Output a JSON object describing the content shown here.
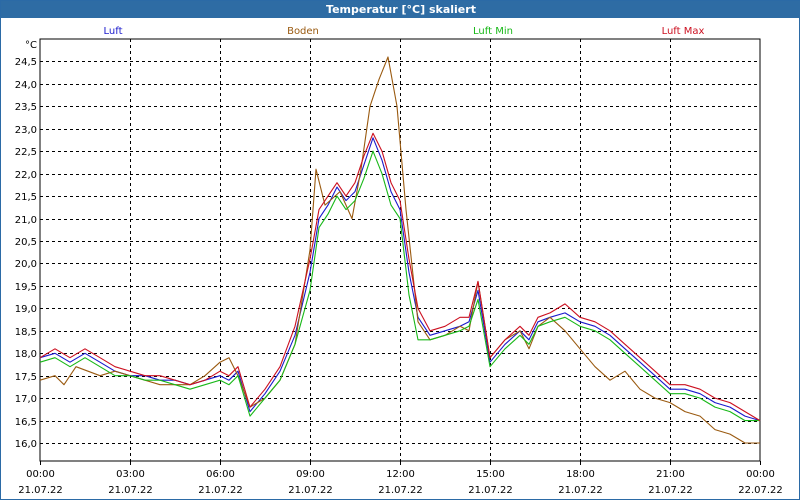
{
  "window": {
    "title": "Temperatur [°C] skaliert"
  },
  "chart_data": {
    "type": "line",
    "title": "Temperatur [°C] skaliert",
    "ylabel": "°C",
    "ylim": [
      15.6,
      25.0
    ],
    "yticks": [
      "16,0",
      "16,5",
      "17,0",
      "17,5",
      "18,0",
      "18,5",
      "19,0",
      "19,5",
      "20,0",
      "20,5",
      "21,0",
      "21,5",
      "22,0",
      "22,5",
      "23,0",
      "23,5",
      "24,0",
      "24,5"
    ],
    "ytick_values": [
      16.0,
      16.5,
      17.0,
      17.5,
      18.0,
      18.5,
      19.0,
      19.5,
      20.0,
      20.5,
      21.0,
      21.5,
      22.0,
      22.5,
      23.0,
      23.5,
      24.0,
      24.5
    ],
    "xlim": [
      0,
      24
    ],
    "xticks": [
      {
        "h": 0,
        "time": "00:00",
        "date": "21.07.22"
      },
      {
        "h": 3,
        "time": "03:00",
        "date": "21.07.22"
      },
      {
        "h": 6,
        "time": "06:00",
        "date": "21.07.22"
      },
      {
        "h": 9,
        "time": "09:00",
        "date": "21.07.22"
      },
      {
        "h": 12,
        "time": "12:00",
        "date": "21.07.22"
      },
      {
        "h": 15,
        "time": "15:00",
        "date": "21.07.22"
      },
      {
        "h": 18,
        "time": "18:00",
        "date": "21.07.22"
      },
      {
        "h": 21,
        "time": "21:00",
        "date": "21.07.22"
      },
      {
        "h": 24,
        "time": "00:00",
        "date": "22.07.22"
      }
    ],
    "grid": true,
    "legend_position": "top",
    "series": [
      {
        "name": "Luft",
        "color": "#1a1acc",
        "points": [
          [
            0,
            17.9
          ],
          [
            0.5,
            18.0
          ],
          [
            1,
            17.8
          ],
          [
            1.5,
            18.0
          ],
          [
            2,
            17.8
          ],
          [
            2.5,
            17.6
          ],
          [
            3,
            17.5
          ],
          [
            3.5,
            17.5
          ],
          [
            4,
            17.4
          ],
          [
            4.5,
            17.4
          ],
          [
            5,
            17.3
          ],
          [
            5.5,
            17.4
          ],
          [
            6,
            17.5
          ],
          [
            6.3,
            17.4
          ],
          [
            6.6,
            17.6
          ],
          [
            7,
            16.7
          ],
          [
            7.5,
            17.1
          ],
          [
            8,
            17.6
          ],
          [
            8.5,
            18.4
          ],
          [
            9,
            19.8
          ],
          [
            9.3,
            21.0
          ],
          [
            9.6,
            21.3
          ],
          [
            9.9,
            21.7
          ],
          [
            10.2,
            21.4
          ],
          [
            10.5,
            21.6
          ],
          [
            10.8,
            22.2
          ],
          [
            11.1,
            22.8
          ],
          [
            11.4,
            22.3
          ],
          [
            11.7,
            21.6
          ],
          [
            12,
            21.2
          ],
          [
            12.3,
            19.8
          ],
          [
            12.6,
            18.8
          ],
          [
            13,
            18.4
          ],
          [
            13.5,
            18.5
          ],
          [
            14,
            18.6
          ],
          [
            14.3,
            18.7
          ],
          [
            14.6,
            19.4
          ],
          [
            15,
            17.8
          ],
          [
            15.5,
            18.2
          ],
          [
            16,
            18.5
          ],
          [
            16.3,
            18.3
          ],
          [
            16.6,
            18.7
          ],
          [
            17,
            18.8
          ],
          [
            17.5,
            18.9
          ],
          [
            18,
            18.7
          ],
          [
            18.5,
            18.6
          ],
          [
            19,
            18.4
          ],
          [
            19.5,
            18.1
          ],
          [
            20,
            17.8
          ],
          [
            20.5,
            17.5
          ],
          [
            21,
            17.2
          ],
          [
            21.5,
            17.2
          ],
          [
            22,
            17.1
          ],
          [
            22.5,
            16.9
          ],
          [
            23,
            16.8
          ],
          [
            23.5,
            16.6
          ],
          [
            24,
            16.5
          ]
        ]
      },
      {
        "name": "Boden",
        "color": "#9a5a10",
        "points": [
          [
            0,
            17.4
          ],
          [
            0.5,
            17.5
          ],
          [
            0.8,
            17.3
          ],
          [
            1.2,
            17.7
          ],
          [
            1.6,
            17.6
          ],
          [
            2,
            17.5
          ],
          [
            2.5,
            17.6
          ],
          [
            3,
            17.5
          ],
          [
            3.5,
            17.4
          ],
          [
            4,
            17.3
          ],
          [
            4.5,
            17.3
          ],
          [
            5,
            17.3
          ],
          [
            5.5,
            17.5
          ],
          [
            6,
            17.8
          ],
          [
            6.3,
            17.9
          ],
          [
            6.6,
            17.5
          ],
          [
            7,
            16.8
          ],
          [
            7.5,
            17.0
          ],
          [
            8,
            17.4
          ],
          [
            8.5,
            18.2
          ],
          [
            9,
            20.3
          ],
          [
            9.2,
            22.1
          ],
          [
            9.5,
            21.3
          ],
          [
            10,
            21.6
          ],
          [
            10.4,
            21.0
          ],
          [
            10.7,
            22.1
          ],
          [
            11,
            23.5
          ],
          [
            11.3,
            24.1
          ],
          [
            11.6,
            24.6
          ],
          [
            11.9,
            23.5
          ],
          [
            12.2,
            21.2
          ],
          [
            12.6,
            18.7
          ],
          [
            13,
            18.3
          ],
          [
            13.5,
            18.4
          ],
          [
            14,
            18.6
          ],
          [
            14.3,
            18.5
          ],
          [
            14.6,
            19.6
          ],
          [
            15,
            17.9
          ],
          [
            15.5,
            18.3
          ],
          [
            16,
            18.5
          ],
          [
            16.3,
            18.1
          ],
          [
            16.6,
            18.6
          ],
          [
            17,
            18.8
          ],
          [
            17.5,
            18.5
          ],
          [
            18,
            18.1
          ],
          [
            18.5,
            17.7
          ],
          [
            19,
            17.4
          ],
          [
            19.5,
            17.6
          ],
          [
            20,
            17.2
          ],
          [
            20.5,
            17.0
          ],
          [
            21,
            16.9
          ],
          [
            21.5,
            16.7
          ],
          [
            22,
            16.6
          ],
          [
            22.5,
            16.3
          ],
          [
            23,
            16.2
          ],
          [
            23.5,
            16.0
          ],
          [
            24,
            16.0
          ]
        ]
      },
      {
        "name": "Luft Min",
        "color": "#18b818",
        "points": [
          [
            0,
            17.8
          ],
          [
            0.5,
            17.9
          ],
          [
            1,
            17.7
          ],
          [
            1.5,
            17.9
          ],
          [
            2,
            17.7
          ],
          [
            2.5,
            17.5
          ],
          [
            3,
            17.5
          ],
          [
            3.5,
            17.4
          ],
          [
            4,
            17.4
          ],
          [
            4.5,
            17.3
          ],
          [
            5,
            17.2
          ],
          [
            5.5,
            17.3
          ],
          [
            6,
            17.4
          ],
          [
            6.3,
            17.3
          ],
          [
            6.6,
            17.5
          ],
          [
            7,
            16.6
          ],
          [
            7.5,
            17.0
          ],
          [
            8,
            17.4
          ],
          [
            8.5,
            18.2
          ],
          [
            9,
            19.4
          ],
          [
            9.3,
            20.8
          ],
          [
            9.6,
            21.1
          ],
          [
            9.9,
            21.5
          ],
          [
            10.2,
            21.2
          ],
          [
            10.5,
            21.4
          ],
          [
            10.8,
            21.9
          ],
          [
            11.1,
            22.5
          ],
          [
            11.4,
            22.0
          ],
          [
            11.7,
            21.3
          ],
          [
            12,
            21.0
          ],
          [
            12.3,
            19.3
          ],
          [
            12.6,
            18.3
          ],
          [
            13,
            18.3
          ],
          [
            13.5,
            18.4
          ],
          [
            14,
            18.5
          ],
          [
            14.3,
            18.6
          ],
          [
            14.6,
            19.2
          ],
          [
            15,
            17.7
          ],
          [
            15.5,
            18.1
          ],
          [
            16,
            18.4
          ],
          [
            16.3,
            18.2
          ],
          [
            16.6,
            18.6
          ],
          [
            17,
            18.7
          ],
          [
            17.5,
            18.8
          ],
          [
            18,
            18.6
          ],
          [
            18.5,
            18.5
          ],
          [
            19,
            18.3
          ],
          [
            19.5,
            18.0
          ],
          [
            20,
            17.7
          ],
          [
            20.5,
            17.4
          ],
          [
            21,
            17.1
          ],
          [
            21.5,
            17.1
          ],
          [
            22,
            17.0
          ],
          [
            22.5,
            16.8
          ],
          [
            23,
            16.7
          ],
          [
            23.5,
            16.5
          ],
          [
            24,
            16.5
          ]
        ]
      },
      {
        "name": "Luft Max",
        "color": "#cc1020",
        "points": [
          [
            0,
            17.9
          ],
          [
            0.5,
            18.1
          ],
          [
            1,
            17.9
          ],
          [
            1.5,
            18.1
          ],
          [
            2,
            17.9
          ],
          [
            2.5,
            17.7
          ],
          [
            3,
            17.6
          ],
          [
            3.5,
            17.5
          ],
          [
            4,
            17.5
          ],
          [
            4.5,
            17.4
          ],
          [
            5,
            17.3
          ],
          [
            5.5,
            17.4
          ],
          [
            6,
            17.6
          ],
          [
            6.3,
            17.5
          ],
          [
            6.6,
            17.7
          ],
          [
            7,
            16.8
          ],
          [
            7.5,
            17.2
          ],
          [
            8,
            17.7
          ],
          [
            8.5,
            18.6
          ],
          [
            9,
            20.1
          ],
          [
            9.3,
            21.2
          ],
          [
            9.6,
            21.5
          ],
          [
            9.9,
            21.8
          ],
          [
            10.2,
            21.5
          ],
          [
            10.5,
            21.8
          ],
          [
            10.8,
            22.4
          ],
          [
            11.1,
            22.9
          ],
          [
            11.4,
            22.5
          ],
          [
            11.7,
            21.8
          ],
          [
            12,
            21.4
          ],
          [
            12.3,
            20.1
          ],
          [
            12.6,
            19.0
          ],
          [
            13,
            18.5
          ],
          [
            13.5,
            18.6
          ],
          [
            14,
            18.8
          ],
          [
            14.3,
            18.8
          ],
          [
            14.6,
            19.6
          ],
          [
            15,
            17.9
          ],
          [
            15.5,
            18.3
          ],
          [
            16,
            18.6
          ],
          [
            16.3,
            18.4
          ],
          [
            16.6,
            18.8
          ],
          [
            17,
            18.9
          ],
          [
            17.5,
            19.1
          ],
          [
            18,
            18.8
          ],
          [
            18.5,
            18.7
          ],
          [
            19,
            18.5
          ],
          [
            19.5,
            18.2
          ],
          [
            20,
            17.9
          ],
          [
            20.5,
            17.6
          ],
          [
            21,
            17.3
          ],
          [
            21.5,
            17.3
          ],
          [
            22,
            17.2
          ],
          [
            22.5,
            17.0
          ],
          [
            23,
            16.9
          ],
          [
            23.5,
            16.7
          ],
          [
            24,
            16.5
          ]
        ]
      }
    ]
  }
}
